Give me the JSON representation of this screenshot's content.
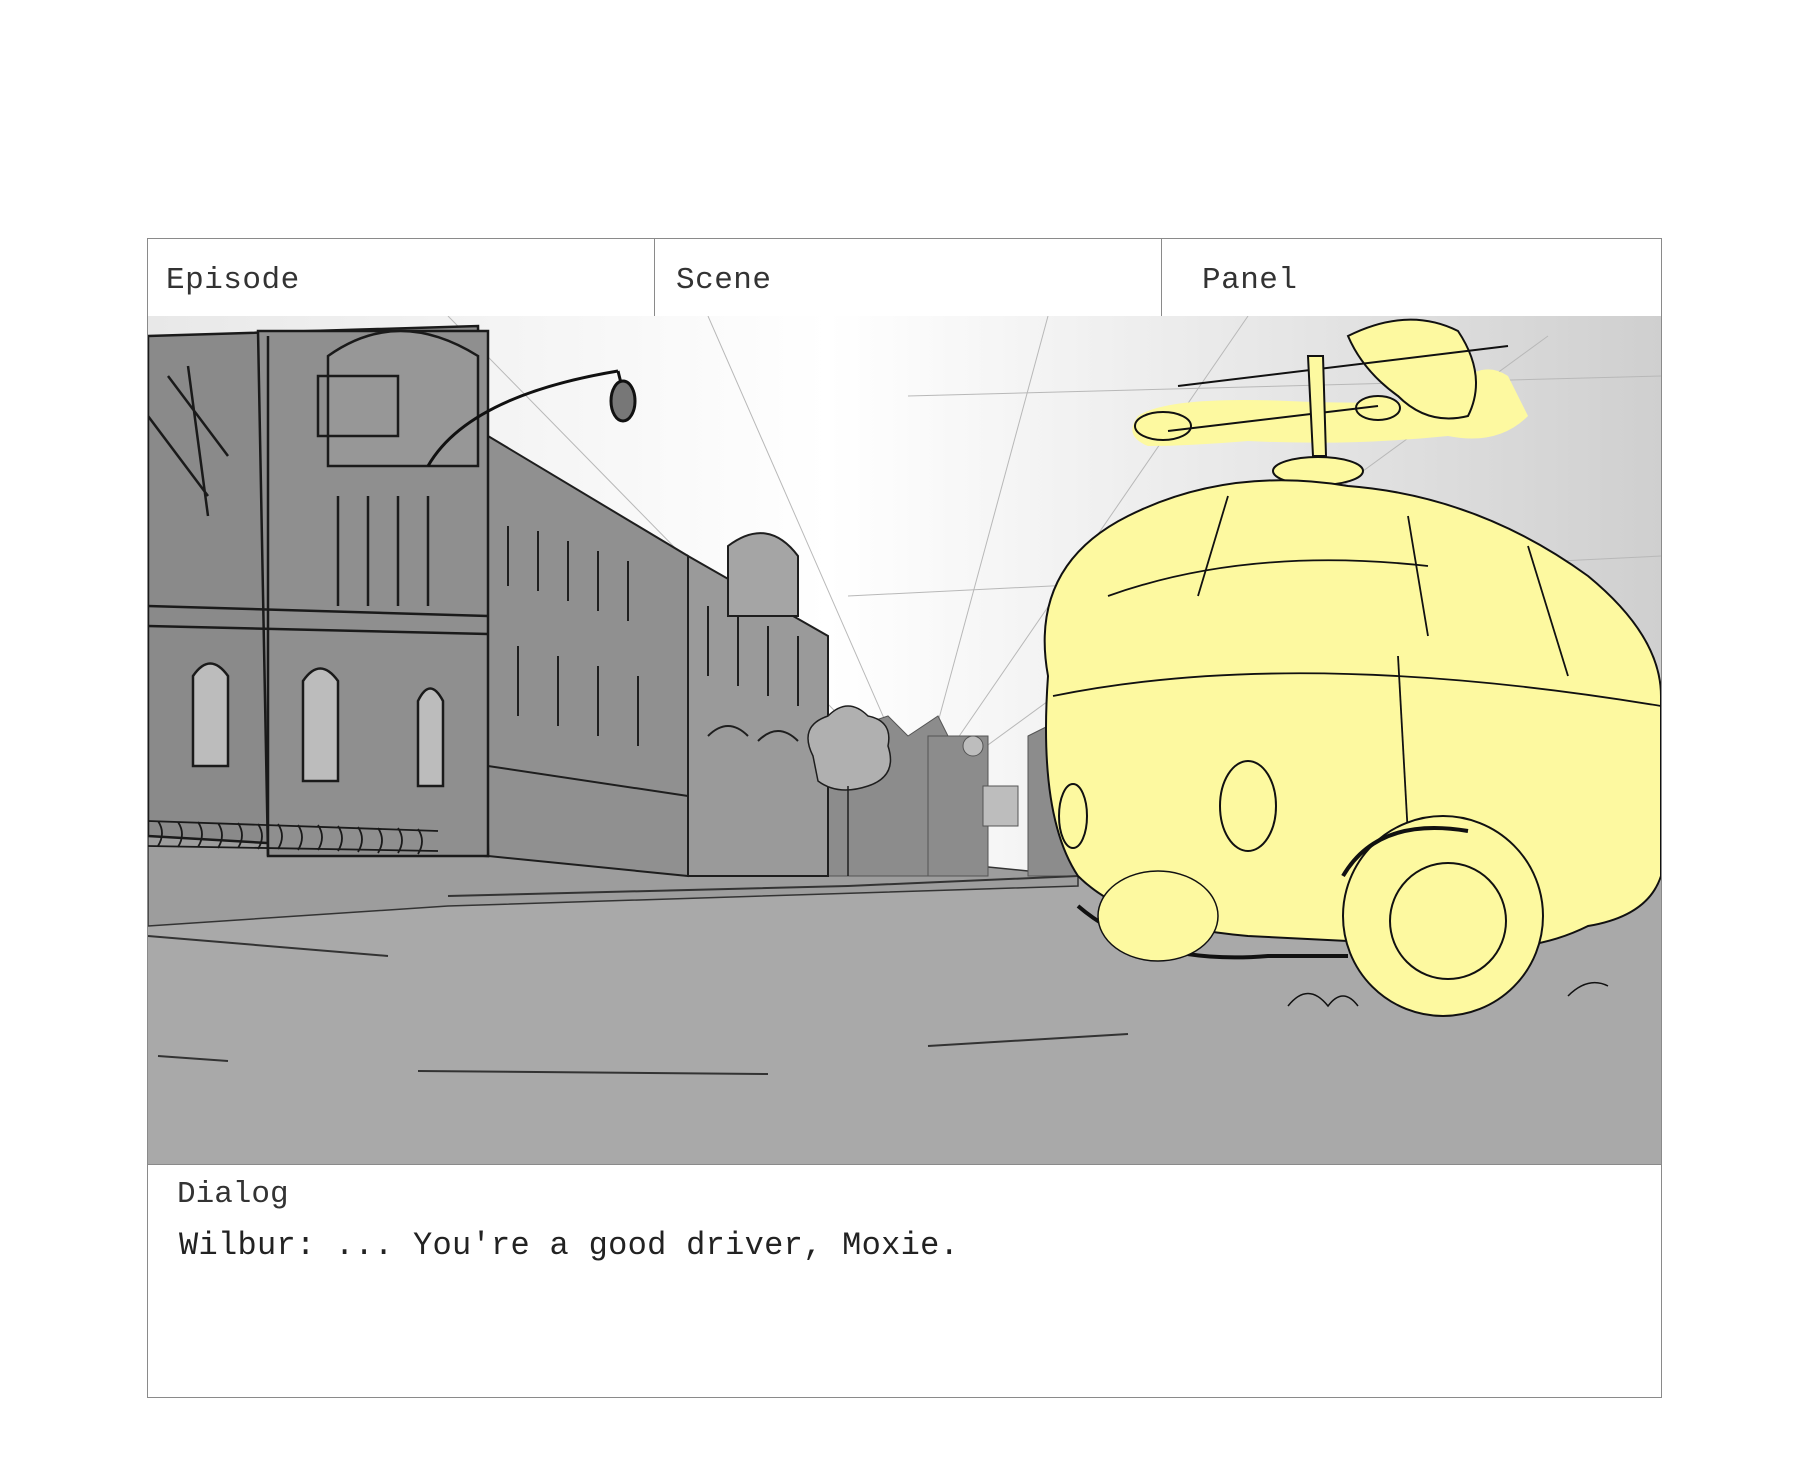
{
  "header": {
    "episode_label": "Episode",
    "scene_label": "Scene",
    "panel_label": "Panel"
  },
  "artwork": {
    "subject": "storyboard-sketch-street-with-yellow-vehicle",
    "highlight_color": "#fdf9a0",
    "ground_color": "#a9a9a9",
    "building_color": "#8f8f8f",
    "sky_color": "#f4f4f4"
  },
  "dialog": {
    "title": "Dialog",
    "line": "Wilbur: ... You're a good driver, Moxie."
  }
}
